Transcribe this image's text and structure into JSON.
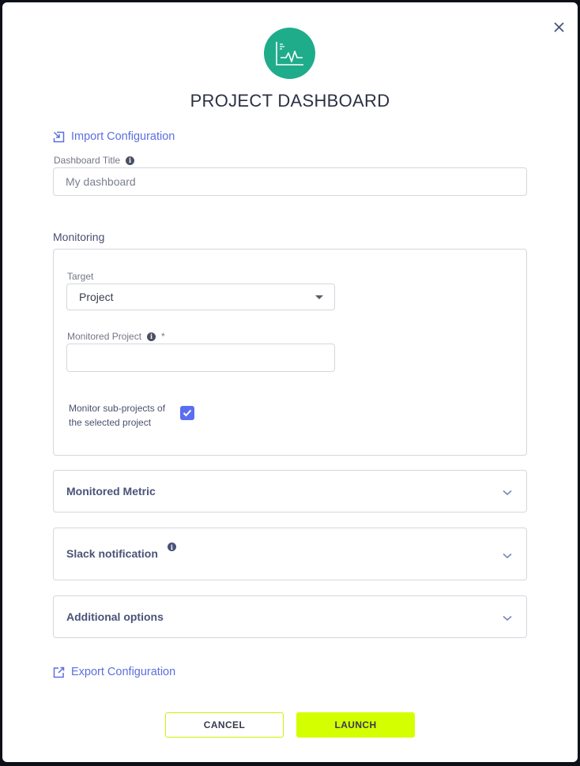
{
  "modal": {
    "title": "PROJECT DASHBOARD",
    "logo_icon": "chart-pulse-icon",
    "close_icon": "close-icon",
    "accent_color": "#1fac8b"
  },
  "import_link": {
    "label": "Import Configuration",
    "icon": "import-icon"
  },
  "dashboard_title": {
    "label": "Dashboard Title",
    "info_icon": "info-icon",
    "placeholder": "My dashboard",
    "value": ""
  },
  "monitoring": {
    "section_label": "Monitoring",
    "target": {
      "label": "Target",
      "selected": "Project"
    },
    "monitored_project": {
      "label": "Monitored Project",
      "required_mark": "*",
      "value": ""
    },
    "sub_projects": {
      "label": "Monitor sub-projects of the selected project",
      "checked": true
    }
  },
  "accordions": [
    {
      "label": "Monitored Metric",
      "has_info": false,
      "expanded": false
    },
    {
      "label": "Slack notification",
      "has_info": true,
      "expanded": false
    },
    {
      "label": "Additional options",
      "has_info": false,
      "expanded": false
    }
  ],
  "export_link": {
    "label": "Export Configuration",
    "icon": "external-link-icon"
  },
  "buttons": {
    "cancel_label": "CANCEL",
    "launch_label": "LAUNCH",
    "launch_color": "#d4ff00"
  }
}
